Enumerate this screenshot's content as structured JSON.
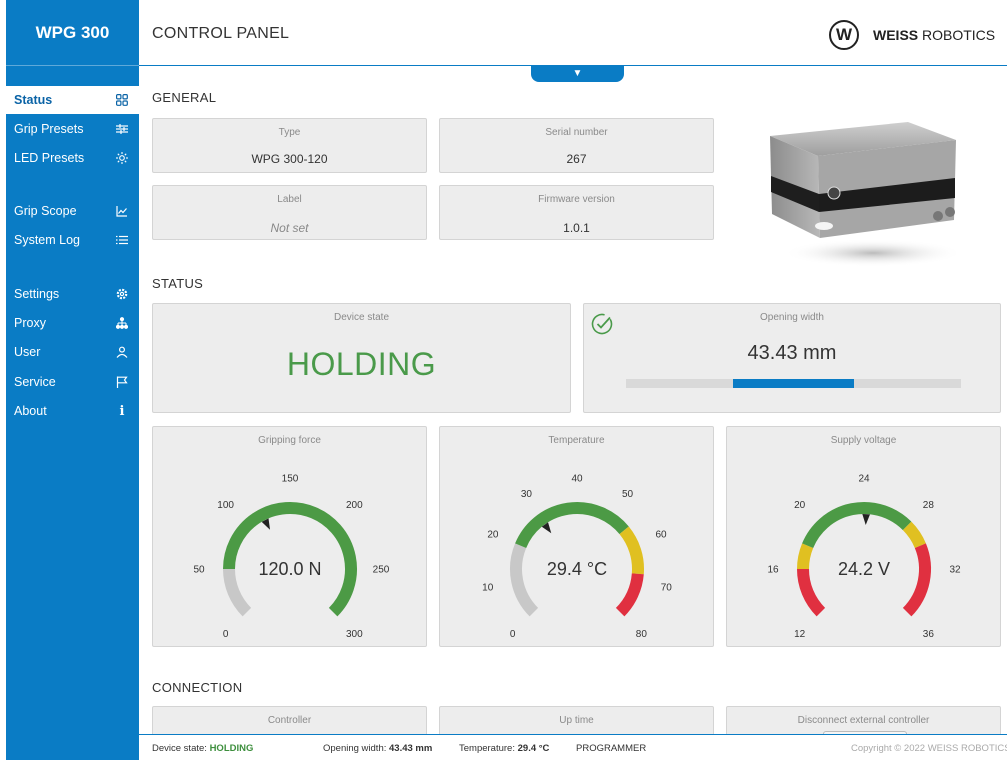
{
  "sidebar": {
    "brand": "WPG 300",
    "items": [
      {
        "label": "Status",
        "icon": "grid-icon"
      },
      {
        "label": "Grip Presets",
        "icon": "sliders-icon"
      },
      {
        "label": "LED Presets",
        "icon": "sun-icon"
      },
      {
        "label": "Grip Scope",
        "icon": "chart-icon"
      },
      {
        "label": "System Log",
        "icon": "list-icon"
      },
      {
        "label": "Settings",
        "icon": "gear-icon"
      },
      {
        "label": "Proxy",
        "icon": "network-icon"
      },
      {
        "label": "User",
        "icon": "user-icon"
      },
      {
        "label": "Service",
        "icon": "flag-icon"
      },
      {
        "label": "About",
        "icon": "info-icon"
      }
    ]
  },
  "header": {
    "title": "CONTROL PANEL",
    "logo_mark": "W",
    "logo_bold": "WEISS",
    "logo_light": "ROBOTICS",
    "collapse_icon": "▼"
  },
  "general": {
    "title": "GENERAL",
    "type_label": "Type",
    "type_value": "WPG 300-120",
    "serial_label": "Serial number",
    "serial_value": "267",
    "label_label": "Label",
    "label_value": "Not set",
    "firmware_label": "Firmware version",
    "firmware_value": "1.0.1"
  },
  "status": {
    "title": "STATUS",
    "device_state_label": "Device state",
    "device_state_value": "HOLDING",
    "opening_label": "Opening width",
    "opening_value": "43.43 mm",
    "opening_bar": {
      "segment_start": 0.32,
      "segment_end": 0.68
    },
    "gauges": [
      {
        "label": "Gripping force",
        "value_text": "120.0 N",
        "value": 120,
        "min": 0,
        "max": 300,
        "ticks": [
          "0",
          "50",
          "100",
          "150",
          "200",
          "250",
          "300"
        ],
        "bands": [
          {
            "from": 0,
            "to": 50,
            "color": "#c8c8c8"
          },
          {
            "from": 50,
            "to": 300,
            "color": "#4c9a45"
          }
        ]
      },
      {
        "label": "Temperature",
        "value_text": "29.4 °C",
        "value": 29.4,
        "min": 0,
        "max": 80,
        "ticks": [
          "0",
          "10",
          "20",
          "30",
          "40",
          "50",
          "60",
          "70",
          "80"
        ],
        "bands": [
          {
            "from": 0,
            "to": 20,
            "color": "#c8c8c8"
          },
          {
            "from": 20,
            "to": 55,
            "color": "#4c9a45"
          },
          {
            "from": 55,
            "to": 68,
            "color": "#e0c021"
          },
          {
            "from": 68,
            "to": 80,
            "color": "#e03040"
          }
        ]
      },
      {
        "label": "Supply voltage",
        "value_text": "24.2 V",
        "value": 24.2,
        "min": 12,
        "max": 36,
        "ticks": [
          "12",
          "16",
          "20",
          "24",
          "28",
          "32",
          "36"
        ],
        "bands": [
          {
            "from": 12,
            "to": 16,
            "color": "#e03040"
          },
          {
            "from": 16,
            "to": 18,
            "color": "#e0c021"
          },
          {
            "from": 18,
            "to": 28,
            "color": "#4c9a45"
          },
          {
            "from": 28,
            "to": 30,
            "color": "#e0c021"
          },
          {
            "from": 30,
            "to": 36,
            "color": "#e03040"
          }
        ]
      }
    ]
  },
  "connection": {
    "title": "CONNECTION",
    "controller_label": "Controller",
    "uptime_label": "Up time",
    "disconnect_label": "Disconnect external controller"
  },
  "footer": {
    "state_prefix": "Device state:",
    "state_value": "HOLDING",
    "opening_prefix": "Opening width:",
    "opening_value": "43.43 mm",
    "temp_prefix": "Temperature:",
    "temp_value": "29.4 °C",
    "mode": "PROGRAMMER",
    "copyright": "Copyright © 2022 WEISS ROBOTICS"
  },
  "colors": {
    "accent": "#0a7cc5",
    "ok": "#4a9a4a",
    "card": "#ededed"
  }
}
